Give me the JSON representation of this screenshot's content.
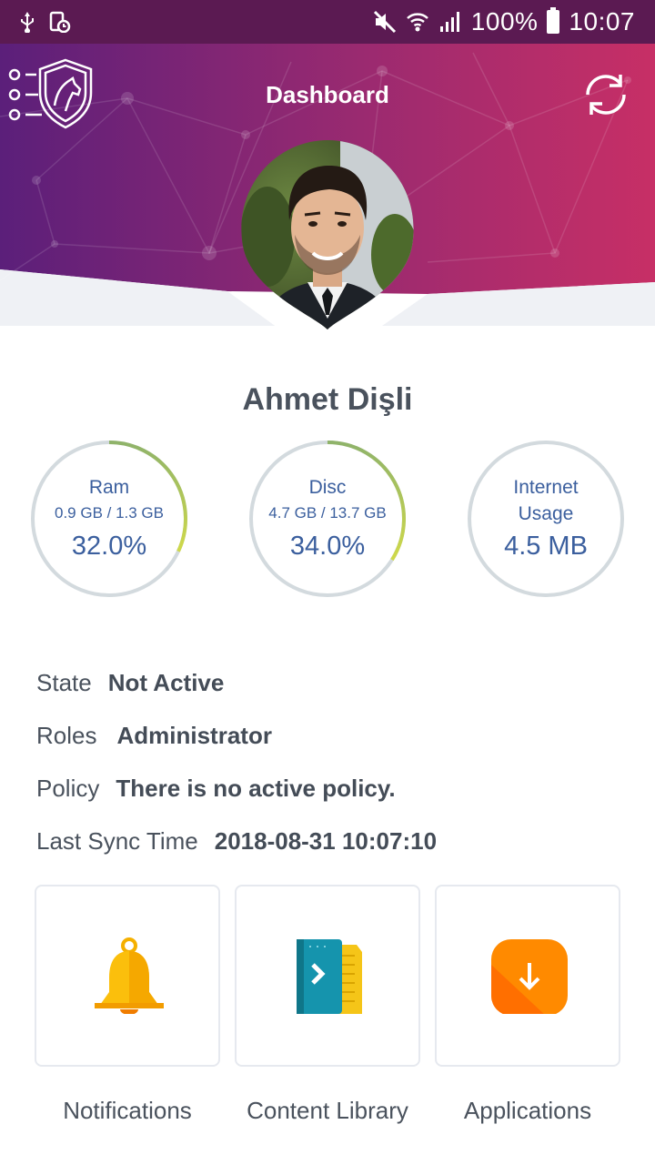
{
  "status_bar": {
    "left_icons": [
      "usb-icon",
      "screen-timer-icon"
    ],
    "right_icons": [
      "mute-icon",
      "wifi-icon",
      "signal-icon"
    ],
    "battery": "100%",
    "time": "10:07"
  },
  "header": {
    "title": "Dashboard",
    "menu_icon": "list-shield-logo-icon",
    "sync_icon": "sync-icon",
    "gradient": [
      "#5b1f7a",
      "#c72f66"
    ]
  },
  "user": {
    "name": "Ahmet Dişli",
    "avatar_icon": "user-avatar"
  },
  "gauges": [
    {
      "title": "Ram",
      "detail": "0.9 GB / 1.3 GB",
      "value": "32.0%",
      "fraction": 0.32
    },
    {
      "title": "Disc",
      "detail": "4.7 GB / 13.7 GB",
      "value": "34.0%",
      "fraction": 0.34
    },
    {
      "title": "Internet",
      "detail": "Usage",
      "value": "4.5 MB",
      "fraction": 0
    }
  ],
  "info": {
    "state_label": "State",
    "state_value": "Not Active",
    "roles_label": "Roles",
    "roles_value": "Administrator",
    "policy_label": "Policy",
    "policy_value": "There is no active policy.",
    "sync_label": "Last Sync Time",
    "sync_value": "2018-08-31 10:07:10"
  },
  "tiles": [
    {
      "label": "Notifications",
      "icon": "bell-icon"
    },
    {
      "label": "Content Library",
      "icon": "book-icon"
    },
    {
      "label": "Applications",
      "icon": "download-icon"
    }
  ],
  "colors": {
    "accent_text": "#3b5f9e",
    "gauge_track": "#d3dade",
    "gauge_progress_start": "#8fb36a",
    "gauge_progress_end": "#cfd94a"
  }
}
